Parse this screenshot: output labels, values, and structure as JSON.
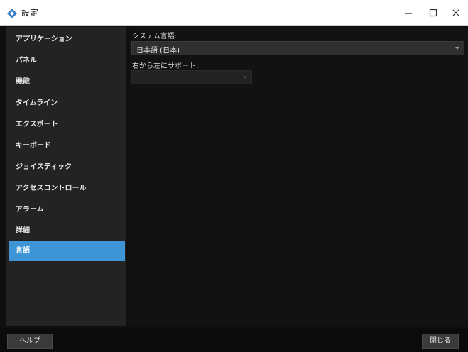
{
  "window": {
    "title": "設定",
    "icon": "app-logo-icon",
    "controls": {
      "minimize": "minimize-icon",
      "maximize": "maximize-icon",
      "close": "close-icon"
    }
  },
  "sidebar": {
    "items": [
      {
        "label": "アプリケーション",
        "selected": false
      },
      {
        "label": "パネル",
        "selected": false
      },
      {
        "label": "機能",
        "selected": false
      },
      {
        "label": "タイムライン",
        "selected": false
      },
      {
        "label": "エクスポート",
        "selected": false
      },
      {
        "label": "キーボード",
        "selected": false
      },
      {
        "label": "ジョイスティック",
        "selected": false
      },
      {
        "label": "アクセスコントロール",
        "selected": false
      },
      {
        "label": "アラーム",
        "selected": false
      },
      {
        "label": "詳細",
        "selected": false
      },
      {
        "label": "言語",
        "selected": true
      }
    ]
  },
  "main": {
    "system_language": {
      "label": "システム言語:",
      "value": "日本語 (日本)"
    },
    "rtl_support": {
      "label": "右から左にサポート:",
      "value": ""
    }
  },
  "footer": {
    "help_label": "ヘルプ",
    "close_label": "閉じる"
  },
  "colors": {
    "accent": "#3d94d6",
    "background": "#121212",
    "sidebar": "#232323"
  }
}
